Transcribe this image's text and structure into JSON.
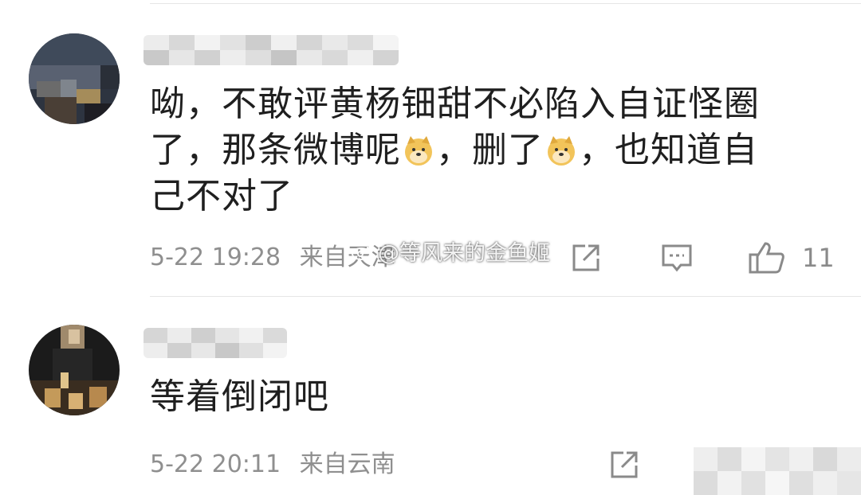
{
  "watermark": "@等风来的金鱼姬",
  "comments": [
    {
      "text_line1": "呦，不敢评黄杨钿甜不必陷入自证怪圈",
      "text_line2a": "了，那条微博呢",
      "text_line2b": "，删了",
      "text_line2c": "，也知道自",
      "text_line3": "己不对了",
      "date": "5-22 19:28",
      "location": "来自天津",
      "likes": "11"
    },
    {
      "text_line1": "等着倒闭吧",
      "date": "5-22 20:11",
      "location": "来自云南"
    }
  ],
  "icons": {
    "share": "share-icon",
    "comment": "comment-icon",
    "like": "thumbs-up-icon",
    "emoji": "doge-emoji-icon"
  },
  "colors": {
    "text": "#1f1f1f",
    "meta": "#8f8f8f",
    "icon": "#8a8a8a",
    "divider": "#e6e6e6"
  }
}
